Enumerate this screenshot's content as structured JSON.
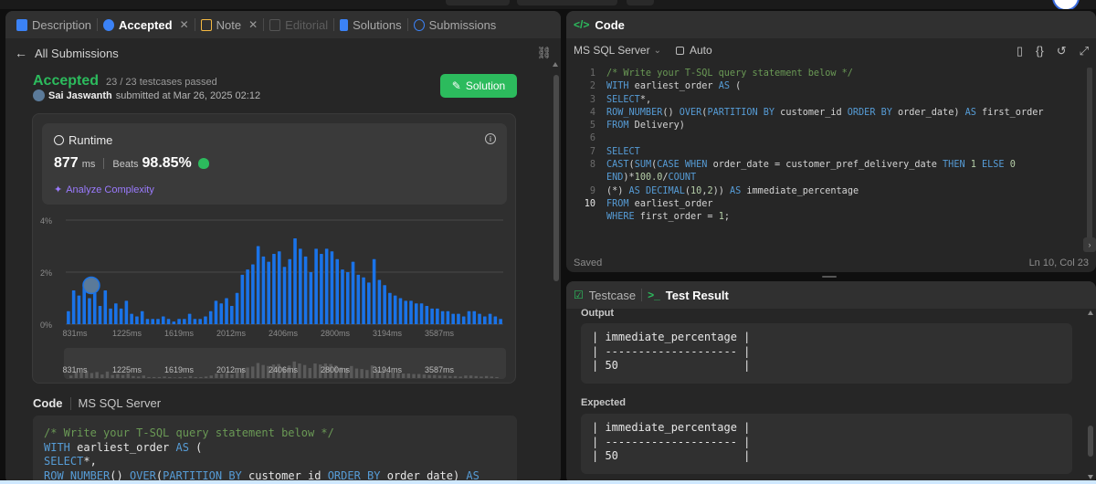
{
  "left_tabs": [
    {
      "label": "Description",
      "state": "normal",
      "icon": "description-icon"
    },
    {
      "label": "Accepted",
      "state": "active",
      "icon": "accepted-icon",
      "closable": true
    },
    {
      "label": "Note",
      "state": "normal",
      "icon": "note-icon",
      "closable": true
    },
    {
      "label": "Editorial",
      "state": "disabled",
      "icon": "editorial-icon"
    },
    {
      "label": "Solutions",
      "state": "normal",
      "icon": "solutions-icon"
    },
    {
      "label": "Submissions",
      "state": "normal",
      "icon": "submissions-icon"
    }
  ],
  "back_link": "All Submissions",
  "submission": {
    "status": "Accepted",
    "testcases": "23 / 23 testcases passed",
    "author": "Sai Jaswanth",
    "submitted_text": "submitted at Mar 26, 2025 02:12",
    "solution_button": "Solution"
  },
  "runtime": {
    "label": "Runtime",
    "value": "877",
    "unit": "ms",
    "beats_label": "Beats",
    "beats_pct": "98.85%",
    "analyze_label": "Analyze Complexity"
  },
  "chart_data": {
    "type": "bar",
    "ylabel_ticks": [
      "4%",
      "2%",
      "0%"
    ],
    "ylim": [
      0,
      4
    ],
    "x_ticks": [
      "831ms",
      "1225ms",
      "1619ms",
      "2012ms",
      "2406ms",
      "2800ms",
      "3194ms",
      "3587ms"
    ],
    "values": [
      0.5,
      1.3,
      1.1,
      1.4,
      1.0,
      1.2,
      0.7,
      1.3,
      0.6,
      0.8,
      0.6,
      0.9,
      0.4,
      0.3,
      0.5,
      0.2,
      0.2,
      0.2,
      0.3,
      0.2,
      0.1,
      0.2,
      0.2,
      0.4,
      0.2,
      0.2,
      0.3,
      0.5,
      0.9,
      0.8,
      1.0,
      0.7,
      1.2,
      1.9,
      2.1,
      2.3,
      3.0,
      2.6,
      2.4,
      2.7,
      2.8,
      2.2,
      2.5,
      3.3,
      2.9,
      2.6,
      2.0,
      2.9,
      2.7,
      2.9,
      2.8,
      2.5,
      2.1,
      2.0,
      2.4,
      1.9,
      1.8,
      1.6,
      2.5,
      1.7,
      1.5,
      1.2,
      1.1,
      1.0,
      0.9,
      0.9,
      0.8,
      0.8,
      0.7,
      0.6,
      0.6,
      0.5,
      0.5,
      0.4,
      0.4,
      0.3,
      0.5,
      0.5,
      0.4,
      0.3,
      0.4,
      0.3,
      0.2
    ],
    "highlight_index": 4,
    "grid": true
  },
  "code_section": {
    "label": "Code",
    "lang": "MS SQL Server",
    "lines": [
      [
        {
          "t": "/* Write your T-SQL query statement below */",
          "c": "cm"
        }
      ],
      [
        {
          "t": "WITH",
          "c": "kw"
        },
        {
          "t": " earliest_order ",
          "c": ""
        },
        {
          "t": "AS",
          "c": "kw"
        },
        {
          "t": " (",
          "c": ""
        }
      ],
      [
        {
          "t": "SELECT",
          "c": "kw"
        },
        {
          "t": "*,",
          "c": ""
        }
      ],
      [
        {
          "t": "ROW_NUMBER",
          "c": "kw"
        },
        {
          "t": "() ",
          "c": ""
        },
        {
          "t": "OVER",
          "c": "kw"
        },
        {
          "t": "(",
          "c": ""
        },
        {
          "t": "PARTITION BY",
          "c": "kw"
        },
        {
          "t": " customer_id ",
          "c": ""
        },
        {
          "t": "ORDER BY",
          "c": "kw"
        },
        {
          "t": " order_date) ",
          "c": ""
        },
        {
          "t": "AS",
          "c": "kw"
        },
        {
          "t": " first_order",
          "c": ""
        }
      ]
    ]
  },
  "code_panel": {
    "title": "Code",
    "language": "MS SQL Server",
    "mode": "Auto",
    "saved": "Saved",
    "cursor": "Ln 10, Col 23",
    "line_numbers": [
      "1",
      "2",
      "3",
      "4",
      "5",
      "6",
      "7",
      "8",
      "",
      "9",
      "10"
    ],
    "lines": [
      [
        {
          "t": "/* Write your T-SQL query statement below */",
          "c": "cm"
        }
      ],
      [
        {
          "t": "WITH",
          "c": "kw"
        },
        {
          "t": " earliest_order ",
          "c": ""
        },
        {
          "t": "AS",
          "c": "kw"
        },
        {
          "t": " (",
          "c": ""
        }
      ],
      [
        {
          "t": "SELECT",
          "c": "kw"
        },
        {
          "t": "*,",
          "c": ""
        }
      ],
      [
        {
          "t": "ROW_NUMBER",
          "c": "kw"
        },
        {
          "t": "() ",
          "c": ""
        },
        {
          "t": "OVER",
          "c": "kw"
        },
        {
          "t": "(",
          "c": ""
        },
        {
          "t": "PARTITION BY",
          "c": "kw"
        },
        {
          "t": " customer_id ",
          "c": ""
        },
        {
          "t": "ORDER BY",
          "c": "kw"
        },
        {
          "t": " order_date) ",
          "c": ""
        },
        {
          "t": "AS",
          "c": "kw"
        },
        {
          "t": " first_order",
          "c": ""
        }
      ],
      [
        {
          "t": "FROM",
          "c": "kw"
        },
        {
          "t": " Delivery)",
          "c": ""
        }
      ],
      [
        {
          "t": "",
          "c": ""
        }
      ],
      [
        {
          "t": "SELECT",
          "c": "kw"
        }
      ],
      [
        {
          "t": "CAST",
          "c": "kw"
        },
        {
          "t": "(",
          "c": ""
        },
        {
          "t": "SUM",
          "c": "kw"
        },
        {
          "t": "(",
          "c": ""
        },
        {
          "t": "CASE WHEN",
          "c": "kw"
        },
        {
          "t": " order_date = customer_pref_delivery_date ",
          "c": ""
        },
        {
          "t": "THEN",
          "c": "kw"
        },
        {
          "t": " ",
          "c": ""
        },
        {
          "t": "1",
          "c": "num"
        },
        {
          "t": " ",
          "c": ""
        },
        {
          "t": "ELSE",
          "c": "kw"
        },
        {
          "t": " ",
          "c": ""
        },
        {
          "t": "0",
          "c": "num"
        },
        {
          "t": " ",
          "c": ""
        },
        {
          "t": "END",
          "c": "kw"
        },
        {
          "t": ")*",
          "c": ""
        },
        {
          "t": "100.0",
          "c": "num"
        },
        {
          "t": "/",
          "c": ""
        },
        {
          "t": "COUNT",
          "c": "kw"
        }
      ],
      [
        {
          "t": "(*) ",
          "c": ""
        },
        {
          "t": "AS DECIMAL",
          "c": "kw"
        },
        {
          "t": "(",
          "c": ""
        },
        {
          "t": "10",
          "c": "num"
        },
        {
          "t": ",",
          "c": ""
        },
        {
          "t": "2",
          "c": "num"
        },
        {
          "t": ")) ",
          "c": ""
        },
        {
          "t": "AS",
          "c": "kw"
        },
        {
          "t": " immediate_percentage",
          "c": ""
        }
      ],
      [
        {
          "t": "FROM",
          "c": "kw"
        },
        {
          "t": " earliest_order",
          "c": ""
        }
      ],
      [
        {
          "t": "WHERE",
          "c": "kw"
        },
        {
          "t": " first_order = ",
          "c": ""
        },
        {
          "t": "1",
          "c": "num"
        },
        {
          "t": ";",
          "c": ""
        }
      ]
    ]
  },
  "result_panel": {
    "tab_testcase": "Testcase",
    "tab_result": "Test Result",
    "output_label": "Output",
    "output_text": "| immediate_percentage |\n| -------------------- |\n| 50                   |",
    "expected_label": "Expected",
    "expected_text": "| immediate_percentage |\n| -------------------- |\n| 50                   |"
  },
  "colors": {
    "accent_green": "#2cbb5d",
    "bar_blue": "#1a73e8",
    "purple": "#9b7bff"
  }
}
